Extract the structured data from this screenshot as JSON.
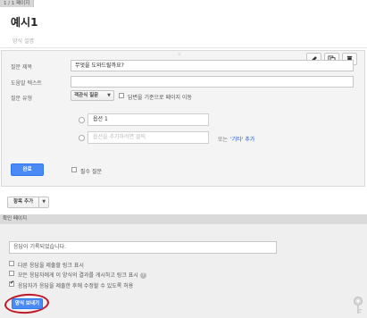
{
  "page": {
    "tab_label": "1 / 1 페이지",
    "form_title": "예시1",
    "form_description": "양식 설명"
  },
  "editor": {
    "grip": "::::",
    "toolbar": {
      "edit_icon": "pencil-icon",
      "copy_icon": "copy-icon",
      "delete_icon": "trash-icon"
    },
    "question_title_label": "질문 제목",
    "question_title_value": "무엇을 도와드릴까요?",
    "help_text_label": "도움말 텍스트",
    "help_text_value": "",
    "question_type_label": "질문 유형",
    "question_type_value": "객관식 질문",
    "page_navigation_label": "답변을 기준으로 페이지 이동",
    "option1_value": "옵션 1",
    "add_option_placeholder": "옵션을 추가하려면 클릭",
    "or_text": "또는",
    "add_other_link": "'기타' 추가",
    "done_button": "완료",
    "required_label": "필수 질문"
  },
  "add_item": {
    "label": "항목 추가"
  },
  "confirmation": {
    "header": "확인 페이지",
    "message_value": "응답이 기록되었습니다.",
    "option1_label": "다른 응답을 제출할 링크 표시",
    "option2_label": "모든 응답자에게 이 양식의 결과를 게시하고 링크 표시",
    "option3_label": "응답자가 응답을 제출한 후에 수정할 수 있도록 허용",
    "help_icon": "?",
    "send_button": "양식 보내기"
  },
  "colors": {
    "primary_button": "#4a8af4",
    "annotation_circle": "#c0182a",
    "link": "#1155cc"
  }
}
